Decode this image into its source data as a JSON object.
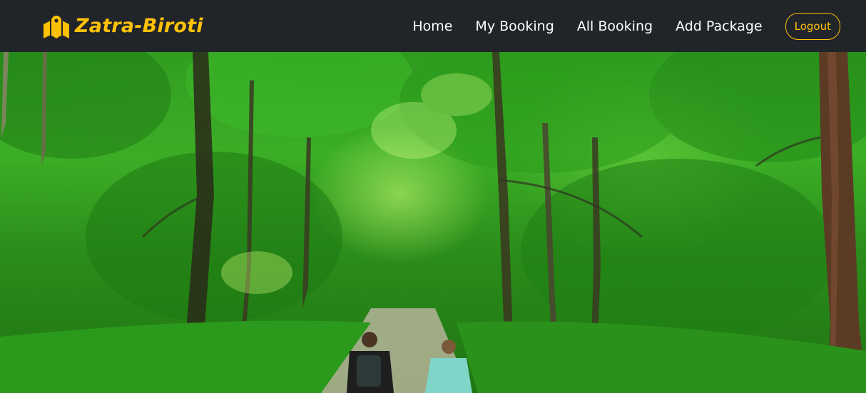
{
  "brand": {
    "name": "Zatra-Biroti",
    "icon": "map-icon",
    "color": "#ffc107"
  },
  "nav": {
    "items": [
      {
        "label": "Home"
      },
      {
        "label": "My Booking"
      },
      {
        "label": "All Booking"
      },
      {
        "label": "Add Package"
      }
    ],
    "logout_label": "Logout"
  },
  "hero": {
    "image": "forest path with two hikers"
  },
  "colors": {
    "navbar_bg": "#212529",
    "accent": "#ffc107"
  }
}
